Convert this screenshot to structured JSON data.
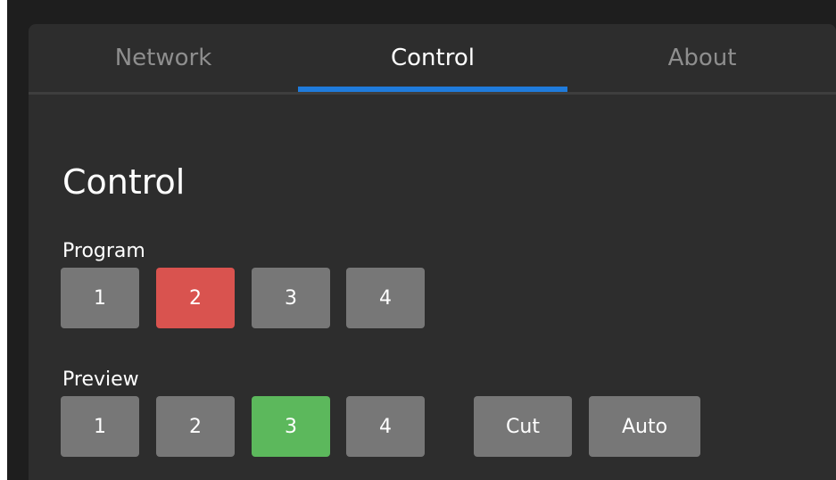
{
  "tabs": [
    {
      "label": "Network",
      "active": false
    },
    {
      "label": "Control",
      "active": true
    },
    {
      "label": "About",
      "active": false
    }
  ],
  "colors": {
    "tab_indicator": "#1f7bdc",
    "program_active": "#d9534f",
    "preview_active": "#5cb85c",
    "button_default": "#777777"
  },
  "control": {
    "title": "Control",
    "program": {
      "label": "Program",
      "buttons": [
        "1",
        "2",
        "3",
        "4"
      ],
      "active": "2"
    },
    "preview": {
      "label": "Preview",
      "buttons": [
        "1",
        "2",
        "3",
        "4"
      ],
      "active": "3"
    },
    "actions": {
      "cut_label": "Cut",
      "auto_label": "Auto"
    }
  }
}
